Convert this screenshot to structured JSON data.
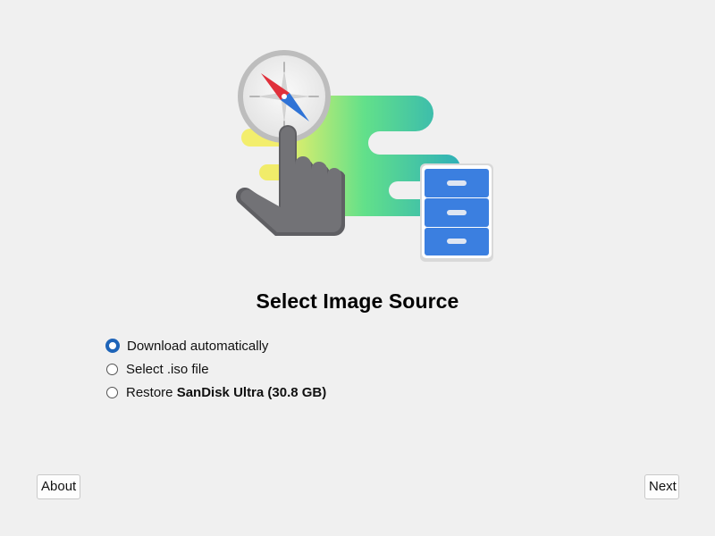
{
  "page": {
    "title": "Select Image Source"
  },
  "options": [
    {
      "label": "Download automatically",
      "selected": true
    },
    {
      "label": "Select .iso file",
      "selected": false
    },
    {
      "label_prefix": "Restore ",
      "label_bold": "SanDisk Ultra (30.8 GB)",
      "selected": false
    }
  ],
  "buttons": {
    "about": "About",
    "next": "Next"
  },
  "colors": {
    "background": "#f0f0f0",
    "radio_accent": "#1e64b8",
    "cabinet_blue": "#3b7fe0",
    "hand_gray": "#6e6e72"
  },
  "illustration": {
    "icons": [
      "compass-icon",
      "pointing-hand-icon",
      "file-cabinet-icon"
    ]
  }
}
